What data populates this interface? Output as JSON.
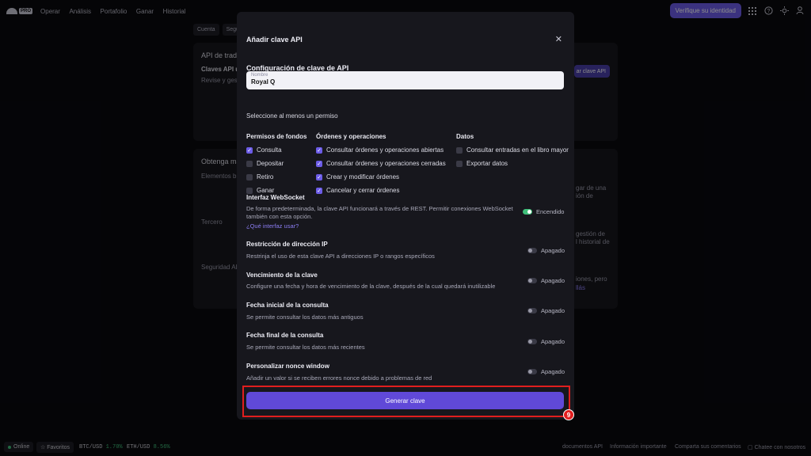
{
  "topbar": {
    "logo_badge": "PRO",
    "nav": [
      "Operar",
      "Análisis",
      "Portafolio",
      "Ganar",
      "Historial"
    ],
    "verify_label": "Verifique su identidad"
  },
  "background": {
    "tabs": [
      "Cuenta",
      "Segu"
    ],
    "panel1_title": "API de trad",
    "panel1_sub": "Claves API u",
    "panel1_desc": "Revise y gest",
    "panel1_btn": "ar clave API",
    "panel2_title": "Obtenga ma",
    "panel2_rows": [
      "Elementos b",
      "Tercero",
      "Seguridad AP"
    ],
    "right_frags": [
      "gar de una",
      "ión de",
      "gestión de",
      "l historial de",
      "iones, pero",
      "llás"
    ]
  },
  "modal": {
    "title": "Añadir clave API",
    "section_title": "Configuración de clave de API",
    "name_label": "Nombre",
    "name_value": "Royal Q",
    "permissions_hint": "Seleccione al menos un permiso",
    "columns": [
      {
        "header": "Permisos de fondos",
        "items": [
          {
            "label": "Consulta",
            "checked": true
          },
          {
            "label": "Depositar",
            "checked": false
          },
          {
            "label": "Retiro",
            "checked": false
          },
          {
            "label": "Ganar",
            "checked": false
          }
        ]
      },
      {
        "header": "Órdenes y operaciones",
        "items": [
          {
            "label": "Consultar órdenes y operaciones abiertas",
            "checked": true
          },
          {
            "label": "Consultar órdenes y operaciones cerradas",
            "checked": true
          },
          {
            "label": "Crear y modificar órdenes",
            "checked": true
          },
          {
            "label": "Cancelar y cerrar órdenes",
            "checked": true
          }
        ]
      },
      {
        "header": "Datos",
        "items": [
          {
            "label": "Consultar entradas en el libro mayor",
            "checked": false
          },
          {
            "label": "Exportar datos",
            "checked": false
          }
        ]
      }
    ],
    "websocket": {
      "title": "Interfaz WebSocket",
      "desc": "De forma predeterminada, la clave API funcionará a través de REST. Permitir conexiones WebSocket también con esta opción.",
      "link": "¿Qué interfaz usar?",
      "state": "Encendido"
    },
    "options": [
      {
        "title": "Restricción de dirección IP",
        "desc": "Restrinja el uso de esta clave API a direcciones IP o rangos específicos",
        "state": "Apagado"
      },
      {
        "title": "Vencimiento de la clave",
        "desc": "Configure una fecha y hora de vencimiento de la clave, después de la cual quedará inutilizable",
        "state": "Apagado"
      },
      {
        "title": "Fecha inicial de la consulta",
        "desc": "Se permite consultar los datos más antiguos",
        "state": "Apagado"
      },
      {
        "title": "Fecha final de la consulta",
        "desc": "Se permite consultar los datos más recientes",
        "state": "Apagado"
      },
      {
        "title": "Personalizar nonce window",
        "desc": "Añadir un valor si se reciben errores nonce debido a problemas de red",
        "state": "Apagado"
      }
    ],
    "generate_label": "Generar clave",
    "step_badge": "9"
  },
  "footer": {
    "online": "Online",
    "favorites": "Favoritos",
    "btc_pair": "BTC/USD",
    "btc_change": "1.70%",
    "eth_pair": "ETH/USD",
    "eth_change": "8.56%",
    "links": [
      "documentos API",
      "Información importante",
      "Comparta sus comentarios",
      "Chatee con nosotros"
    ]
  }
}
